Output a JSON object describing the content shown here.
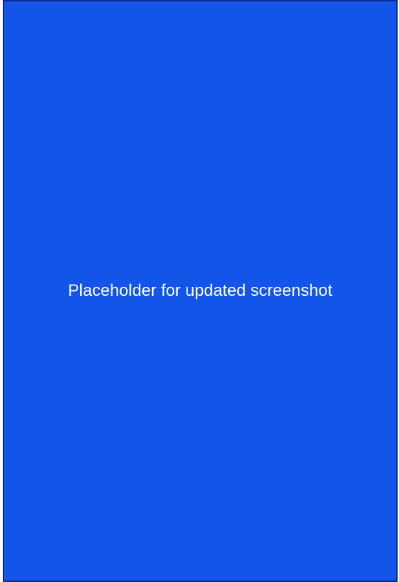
{
  "screen": {
    "message": "Placeholder for updated screenshot"
  },
  "colors": {
    "background": "#1255e8",
    "border": "#0b2a8a",
    "text": "#ffffff"
  }
}
